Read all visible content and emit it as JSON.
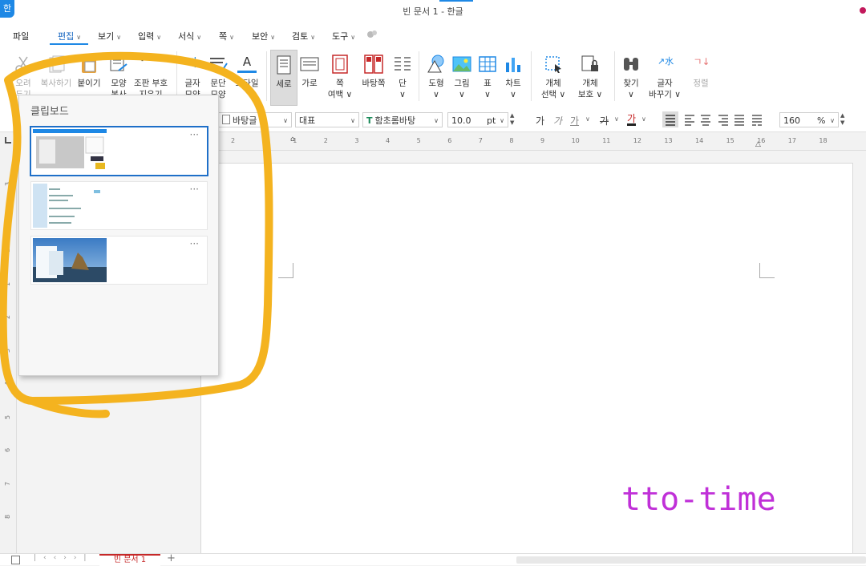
{
  "window": {
    "title": "빈 문서 1 - 한글",
    "app_logo": "한"
  },
  "menu": {
    "items": [
      {
        "label": "파일",
        "chev": false
      },
      {
        "label": "편집",
        "chev": true
      },
      {
        "label": "보기",
        "chev": true
      },
      {
        "label": "입력",
        "chev": true
      },
      {
        "label": "서식",
        "chev": true
      },
      {
        "label": "쪽",
        "chev": true
      },
      {
        "label": "보안",
        "chev": true
      },
      {
        "label": "검토",
        "chev": true
      },
      {
        "label": "도구",
        "chev": true
      }
    ],
    "active": "편집",
    "chevron": "∨"
  },
  "ribbon": {
    "cut": {
      "label": "오려",
      "label2": "두기"
    },
    "copy": {
      "label": "복사하기"
    },
    "paste": {
      "label": "붙이기"
    },
    "shape_copy": {
      "label": "모양",
      "label2": "복사"
    },
    "symbol": {
      "label": "조판 부호",
      "label2": "지우기",
      "icon_text": "[###]"
    },
    "char_shape": {
      "label": "글자",
      "label2": "모양",
      "icon_text": "가"
    },
    "para_shape": {
      "label": "문단",
      "label2": "모양"
    },
    "style": {
      "label": "스타일",
      "icon_text": "A"
    },
    "vertical": {
      "label": "세로"
    },
    "horizontal": {
      "label": "가로"
    },
    "page_margin": {
      "label": "쪽",
      "label2": "여백 ∨"
    },
    "background": {
      "label": "바탕쪽"
    },
    "column": {
      "label": "단",
      "label2": "∨"
    },
    "shape": {
      "label": "도형",
      "label2": "∨"
    },
    "picture": {
      "label": "그림",
      "label2": "∨"
    },
    "table": {
      "label": "표",
      "label2": "∨"
    },
    "chart": {
      "label": "차트",
      "label2": "∨"
    },
    "object_select": {
      "label": "개체",
      "label2": "선택 ∨"
    },
    "object_protect": {
      "label": "개체",
      "label2": "보호 ∨"
    },
    "find": {
      "label": "찾기",
      "label2": "∨"
    },
    "replace_char": {
      "label": "글자",
      "label2": "바꾸기 ∨",
      "icon_text": "↗水"
    },
    "sort": {
      "label": "정렬",
      "icon_text": "ㄱ↓"
    }
  },
  "format_toolbar": {
    "style_combo": "바탕글",
    "lang_combo": "대표",
    "font_combo": "함초롬바탕",
    "font_size": "10.0",
    "font_unit": "pt",
    "bold": "가",
    "italic": "가",
    "underline": "가",
    "strike": "가",
    "color": "가",
    "zoom": "160",
    "zoom_unit": "%",
    "arrow": "∨"
  },
  "ruler": {
    "h_ticks": [
      "2",
      "1",
      "1",
      "2",
      "3",
      "4",
      "5",
      "6",
      "7",
      "8",
      "9",
      "10",
      "11",
      "12",
      "13",
      "14",
      "15",
      "16",
      "17",
      "18"
    ],
    "v_ticks": [
      "3",
      "2",
      "1",
      "1",
      "2",
      "3",
      "4",
      "5",
      "6",
      "7",
      "8"
    ]
  },
  "clipboard": {
    "title": "클립보드",
    "more": "···"
  },
  "watermark": "tto-time",
  "statusbar": {
    "doc_tab": "빈 문서 1",
    "add_tab": "+"
  },
  "colors": {
    "accent": "#1e88e5",
    "highlight": "#f4b31f",
    "watermark": "#c030d8"
  }
}
